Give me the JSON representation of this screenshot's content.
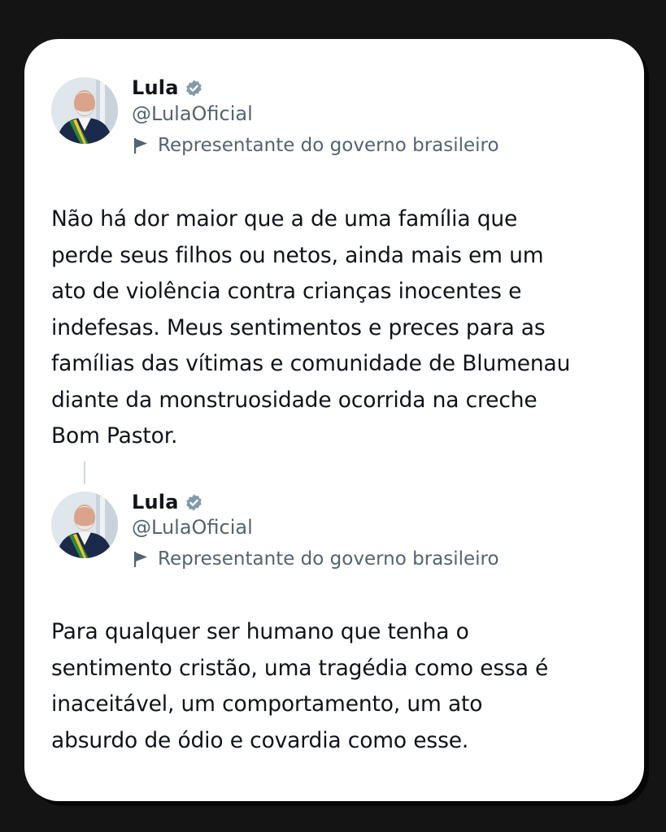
{
  "tweets": [
    {
      "author": {
        "name": "Lula",
        "handle": "@LulaOficial",
        "verified_icon": "verified-badge-icon",
        "label_icon": "flag-icon",
        "label": "Representante do governo brasileiro"
      },
      "text": "Não há dor maior que a de uma família que\nperde seus filhos ou netos, ainda mais em um\nato de violência contra crianças inocentes e\nindefesas. Meus sentimentos e preces para as\nfamílias das vítimas e comunidade de Blumenau\ndiante da monstruosidade ocorrida na creche\nBom Pastor."
    },
    {
      "author": {
        "name": "Lula",
        "handle": "@LulaOficial",
        "verified_icon": "verified-badge-icon",
        "label_icon": "flag-icon",
        "label": "Representante do governo brasileiro"
      },
      "text": "Para qualquer ser humano que tenha o\nsentimento cristão, uma tragédia como essa é\ninaceitável, um comportamento, um ato\nabsurdo de ódio e covardia como esse."
    }
  ],
  "colors": {
    "background": "#141414",
    "card": "#ffffff",
    "text_primary": "#0f1419",
    "text_secondary": "#536471",
    "verified_badge": "#829aab"
  }
}
